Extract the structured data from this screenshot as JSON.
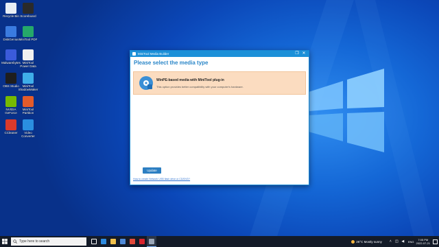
{
  "desktop": {
    "icons": [
      {
        "label": "Recycle Bin",
        "color": "#e8eef5",
        "icon": "recycle-bin-icon"
      },
      {
        "label": "Scoreboard",
        "color": "#2a2a2a",
        "icon": "scoreboard-icon"
      },
      {
        "label": "DiskGenius",
        "color": "#3a7be0",
        "icon": "diskgenius-icon"
      },
      {
        "label": "MiniTool PDF",
        "color": "#25a86a",
        "icon": "pdf-editor-icon"
      },
      {
        "label": "Malwarebytes",
        "color": "#3b5bdb",
        "icon": "malwarebytes-icon"
      },
      {
        "label": "MiniTool Power Data",
        "color": "#f0f0f0",
        "icon": "power-data-icon"
      },
      {
        "label": "OBS Studio",
        "color": "#1e1e1e",
        "icon": "obs-icon"
      },
      {
        "label": "MiniTool ShadowMaker",
        "color": "#3faee8",
        "icon": "shadowmaker-icon"
      },
      {
        "label": "NVIDIA GeForce Experience",
        "color": "#76b900",
        "icon": "nvidia-icon"
      },
      {
        "label": "MiniTool Partition Wizard",
        "color": "#e45b2a",
        "icon": "partition-wizard-icon"
      },
      {
        "label": "CCleaner",
        "color": "#d93a2b",
        "icon": "ccleaner-icon"
      },
      {
        "label": "Video Converter",
        "color": "#2a8fe0",
        "icon": "video-converter-icon"
      }
    ]
  },
  "window": {
    "title": "MiniTool Media Builder",
    "heading": "Please select the media type",
    "option_title": "WinPE-based media with MiniTool plug-in",
    "option_desc": "This option provides better compatibility with your computer's hardware.",
    "update_label": "Update",
    "help_link": "How to create Network USB flash drive or CD/DVD?",
    "controls": {
      "restore": "❐",
      "close": "✕"
    }
  },
  "taskbar": {
    "search_placeholder": "Type here to search",
    "apps": [
      {
        "name": "task-view",
        "color": "#ffffff"
      },
      {
        "name": "edge",
        "color": "#2e8be0"
      },
      {
        "name": "file-explorer",
        "color": "#f2c14b"
      },
      {
        "name": "store",
        "color": "#4f8ad8"
      },
      {
        "name": "chrome",
        "color": "#e24a3b"
      },
      {
        "name": "opera",
        "color": "#d8242e"
      },
      {
        "name": "media-builder",
        "color": "#9aa6b8"
      }
    ],
    "weather": "26°C  Mostly sunny",
    "lang": "ENG",
    "time": "7:05 PM",
    "date": "2022-07-21"
  }
}
